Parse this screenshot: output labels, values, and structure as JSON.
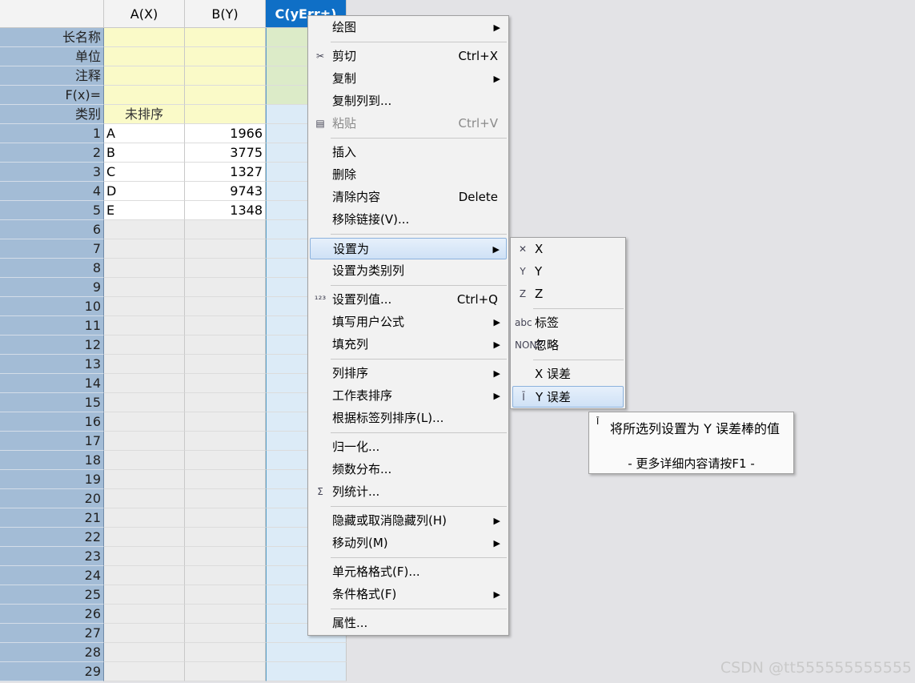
{
  "sheet": {
    "columns": [
      "A(X)",
      "B(Y)",
      "C(yErr±)"
    ],
    "meta_rows": [
      "长名称",
      "单位",
      "注释",
      "F(x)=",
      "类别"
    ],
    "category_value": "未排序",
    "rows": [
      {
        "n": "1",
        "a": "A",
        "b": "1966"
      },
      {
        "n": "2",
        "a": "B",
        "b": "3775"
      },
      {
        "n": "3",
        "a": "C",
        "b": "1327"
      },
      {
        "n": "4",
        "a": "D",
        "b": "9743"
      },
      {
        "n": "5",
        "a": "E",
        "b": "1348"
      }
    ],
    "empty_row_numbers": [
      "6",
      "7",
      "8",
      "9",
      "10",
      "11",
      "12",
      "13",
      "14",
      "15",
      "16",
      "17",
      "18",
      "19",
      "20",
      "21",
      "22",
      "23",
      "24",
      "25",
      "26",
      "27",
      "28",
      "29"
    ]
  },
  "menu": {
    "items": [
      {
        "label": "绘图",
        "sub": true
      },
      {
        "sep": true
      },
      {
        "label": "剪切",
        "shortcut": "Ctrl+X",
        "icon": "scissors-icon",
        "glyph": "✂"
      },
      {
        "label": "复制",
        "sub": true
      },
      {
        "label": "复制列到..."
      },
      {
        "label": "粘贴",
        "shortcut": "Ctrl+V",
        "icon": "paste-icon",
        "glyph": "▤",
        "disabled": true
      },
      {
        "sep": true
      },
      {
        "label": "插入"
      },
      {
        "label": "删除"
      },
      {
        "label": "清除内容",
        "shortcut": "Delete"
      },
      {
        "label": "移除链接(V)..."
      },
      {
        "sep": true
      },
      {
        "label": "设置为",
        "sub": true,
        "highlight": true
      },
      {
        "label": "设置为类别列"
      },
      {
        "sep": true
      },
      {
        "label": "设置列值...",
        "shortcut": "Ctrl+Q",
        "icon": "set-values-icon",
        "glyph": "¹²³"
      },
      {
        "label": "填写用户公式",
        "sub": true
      },
      {
        "label": "填充列",
        "sub": true
      },
      {
        "sep": true
      },
      {
        "label": "列排序",
        "sub": true
      },
      {
        "label": "工作表排序",
        "sub": true
      },
      {
        "label": "根据标签列排序(L)..."
      },
      {
        "sep": true
      },
      {
        "label": "归一化..."
      },
      {
        "label": "频数分布..."
      },
      {
        "label": "列统计...",
        "icon": "sigma-icon",
        "glyph": "Σ"
      },
      {
        "sep": true
      },
      {
        "label": "隐藏或取消隐藏列(H)",
        "sub": true
      },
      {
        "label": "移动列(M)",
        "sub": true
      },
      {
        "sep": true
      },
      {
        "label": "单元格格式(F)..."
      },
      {
        "label": "条件格式(F)",
        "sub": true
      },
      {
        "sep": true
      },
      {
        "label": "属性..."
      }
    ]
  },
  "submenu": {
    "items": [
      {
        "label": "X",
        "icon": "x-axis-icon",
        "glyph": "✕"
      },
      {
        "label": "Y",
        "icon": "y-axis-icon",
        "glyph": "Y"
      },
      {
        "label": "Z",
        "icon": "z-axis-icon",
        "glyph": "Z"
      },
      {
        "sep": true
      },
      {
        "label": "标签",
        "icon": "label-icon",
        "glyph": "abc"
      },
      {
        "label": "忽略",
        "icon": "none-icon",
        "glyph": "NONE"
      },
      {
        "sep": true
      },
      {
        "label": "X 误差"
      },
      {
        "label": "Y 误差",
        "icon": "y-error-icon",
        "glyph": "Ī",
        "highlight": true
      }
    ]
  },
  "tooltip": {
    "line1": "将所选列设置为 Y 误差棒的值",
    "line2": "- 更多详细内容请按F1 -"
  },
  "watermark": "CSDN @tt555555555555",
  "colors": {
    "row_header": "#a3bcd6",
    "selected_column": "#0f6fc6",
    "meta_fill": "#fafac8"
  }
}
